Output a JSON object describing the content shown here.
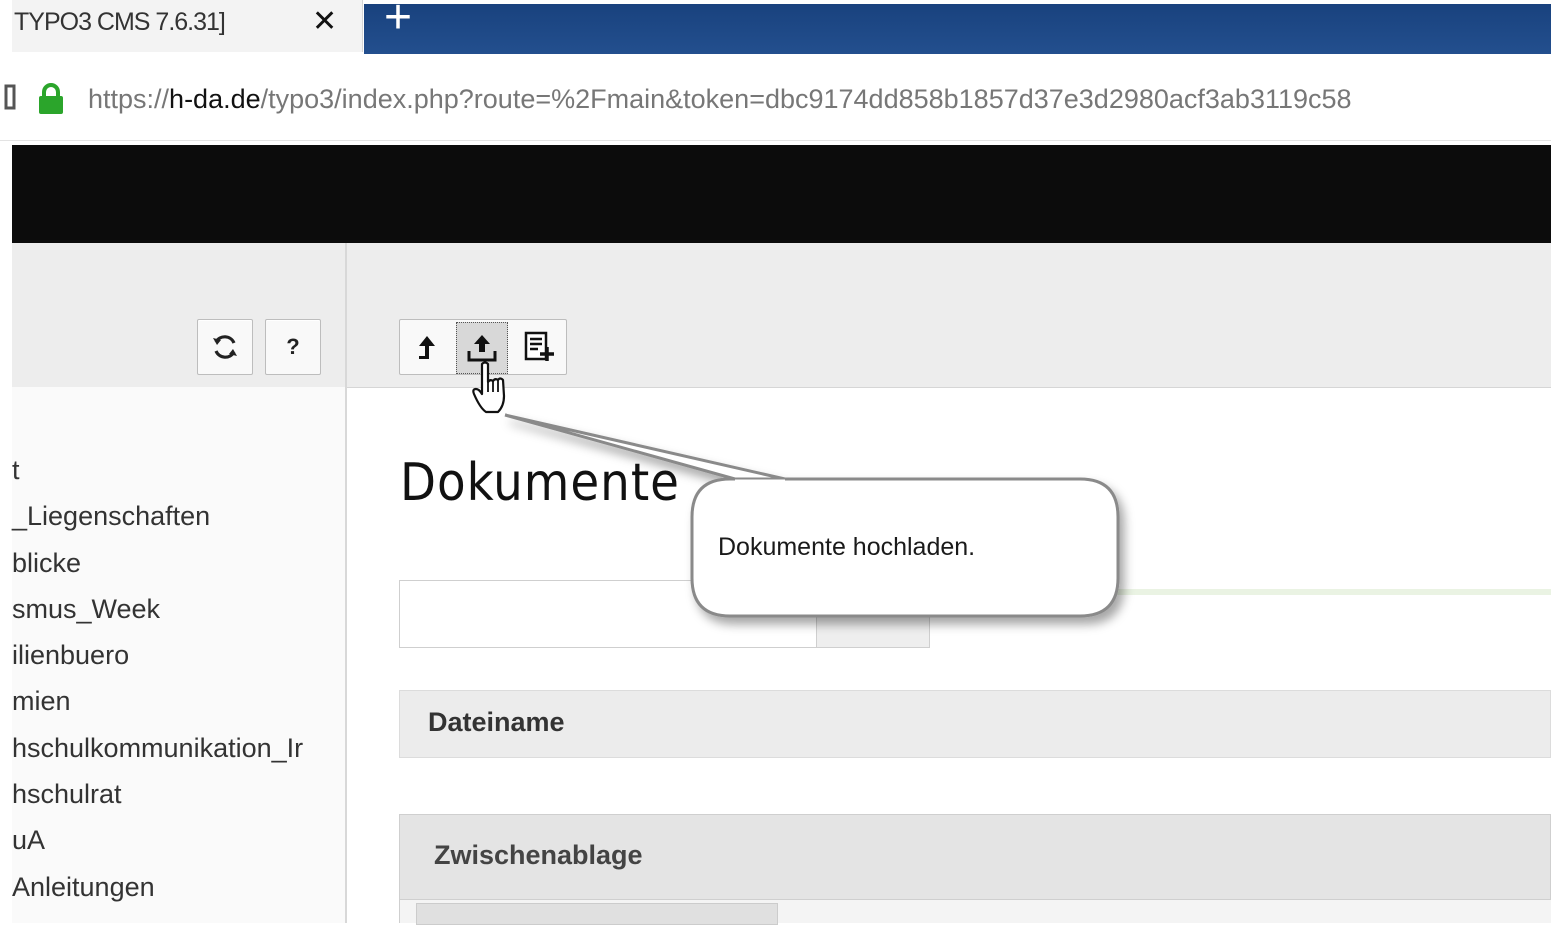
{
  "browser": {
    "tab_title": "TYPO3 CMS 7.6.31]",
    "tab_close": "✕",
    "new_tab": "+",
    "url_scheme": "https://",
    "url_host": "h-da.de",
    "url_path": "/typo3/index.php?route=%2Fmain&token=dbc9174dd858b1857d37e3d2980acf3ab3119c58"
  },
  "left_panel": {
    "refresh_icon": "refresh-icon",
    "help_label": "?",
    "tree_items": [
      "t",
      "_Liegenschaften",
      "blicke",
      "smus_Week",
      "ilienbuero",
      "mien",
      "hschulkommunikation_Ir",
      "hschulrat",
      "uA",
      "Anleitungen"
    ]
  },
  "toolbar": {
    "icons": [
      "up-arrow-icon",
      "upload-icon",
      "new-file-icon"
    ]
  },
  "main": {
    "title": "Dokumente",
    "search_value": "",
    "search_button_label": "",
    "column_header": "Dateiname",
    "clipboard_title": "Zwischenablage"
  },
  "callout": {
    "text": "Dokumente hochladen."
  },
  "colors": {
    "topbar": "#0c0c0c",
    "browser_accent": "#1f4a88",
    "lock_green": "#2ba52b"
  }
}
